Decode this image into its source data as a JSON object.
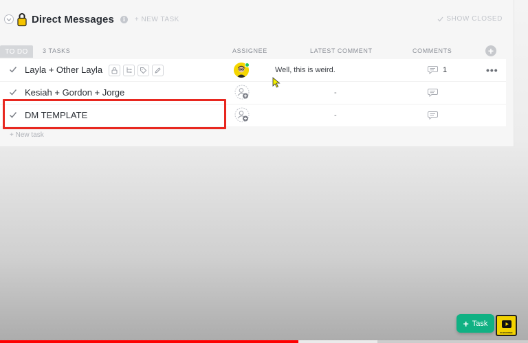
{
  "list": {
    "title": "Direct Messages",
    "new_task_label": "+ NEW TASK",
    "show_closed_label": "SHOW CLOSED",
    "bottom_new_task": "+ New task"
  },
  "group": {
    "status": "TO DO",
    "count_label": "3 TASKS"
  },
  "columns": {
    "assignee": "ASSIGNEE",
    "latest_comment": "LATEST COMMENT",
    "comments": "COMMENTS"
  },
  "tasks": [
    {
      "name": "Layla + Other Layla",
      "latest_comment": "Well, this is weird.",
      "comment_count": "1"
    },
    {
      "name": "Kesiah + Gordon + Jorge",
      "latest_comment": "-",
      "comment_count": ""
    },
    {
      "name": "DM TEMPLATE",
      "latest_comment": "-",
      "comment_count": ""
    }
  ],
  "fab": {
    "label": "Task"
  },
  "subscribe_badge": {
    "text": "SUBSCRIBE"
  },
  "video": {
    "progress": 0.565,
    "buffered": 0.715
  },
  "colors": {
    "accent_green": "#10b183",
    "highlight_red": "#e8271f",
    "avatar_yellow": "#f5d600",
    "progress_red": "#ff0000"
  },
  "icons": {
    "collapse": "chevron-down-icon",
    "list": "lock-icon",
    "info": "info-icon",
    "check": "check-icon",
    "row_actions": [
      "lock-icon",
      "subtask-icon",
      "tag-icon",
      "pencil-icon"
    ],
    "unassigned": "add-assignee-icon",
    "comment": "comment-bubble-icon",
    "more": "more-dots-icon",
    "add_column": "plus-icon",
    "cursor": "mouse-cursor-icon",
    "subscribe": "play-icon"
  }
}
